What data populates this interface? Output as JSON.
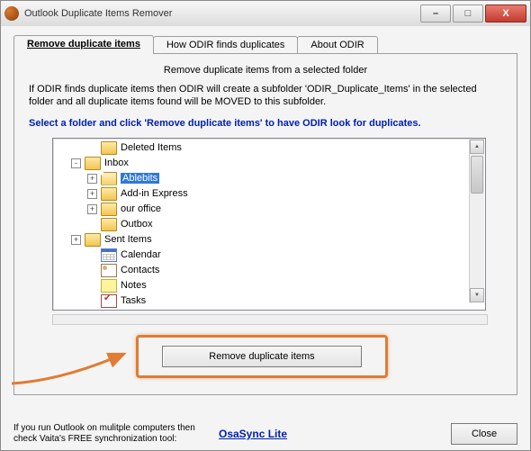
{
  "window": {
    "title": "Outlook Duplicate Items Remover"
  },
  "win_controls": {
    "min": "–",
    "max": "□",
    "close": "X"
  },
  "tabs": [
    {
      "label": "Remove duplicate items",
      "active": true
    },
    {
      "label": "How ODIR finds duplicates",
      "active": false
    },
    {
      "label": "About ODIR",
      "active": false
    }
  ],
  "panel": {
    "intro": "Remove duplicate items from a selected folder",
    "explain": "If ODIR finds duplicate items then ODIR will create a subfolder 'ODIR_Duplicate_Items' in the selected folder and all duplicate items found will be MOVED to this subfolder.",
    "instruction": "Select a folder and click 'Remove duplicate items' to have ODIR look for duplicates."
  },
  "tree": {
    "nodes": [
      {
        "indent": 2,
        "expander": "",
        "icon": "folder",
        "label": "Deleted Items"
      },
      {
        "indent": 1,
        "expander": "-",
        "icon": "folder",
        "label": "Inbox"
      },
      {
        "indent": 2,
        "expander": "+",
        "icon": "folder-open",
        "label": "Ablebits",
        "selected": true
      },
      {
        "indent": 2,
        "expander": "+",
        "icon": "folder",
        "label": "Add-in Express"
      },
      {
        "indent": 2,
        "expander": "+",
        "icon": "folder",
        "label": "our office"
      },
      {
        "indent": 2,
        "expander": "",
        "icon": "folder",
        "label": "Outbox"
      },
      {
        "indent": 1,
        "expander": "+",
        "icon": "folder",
        "label": "Sent Items"
      },
      {
        "indent": 2,
        "expander": "",
        "icon": "calendar",
        "label": "Calendar"
      },
      {
        "indent": 2,
        "expander": "",
        "icon": "contacts",
        "label": "Contacts"
      },
      {
        "indent": 2,
        "expander": "",
        "icon": "notes",
        "label": "Notes"
      },
      {
        "indent": 2,
        "expander": "",
        "icon": "tasks",
        "label": "Tasks"
      }
    ]
  },
  "buttons": {
    "remove": "Remove duplicate items",
    "close": "Close"
  },
  "footer": {
    "text": "If you run Outlook on mulitple computers then check Vaita's FREE synchronization tool:",
    "link": "OsaSync Lite"
  }
}
